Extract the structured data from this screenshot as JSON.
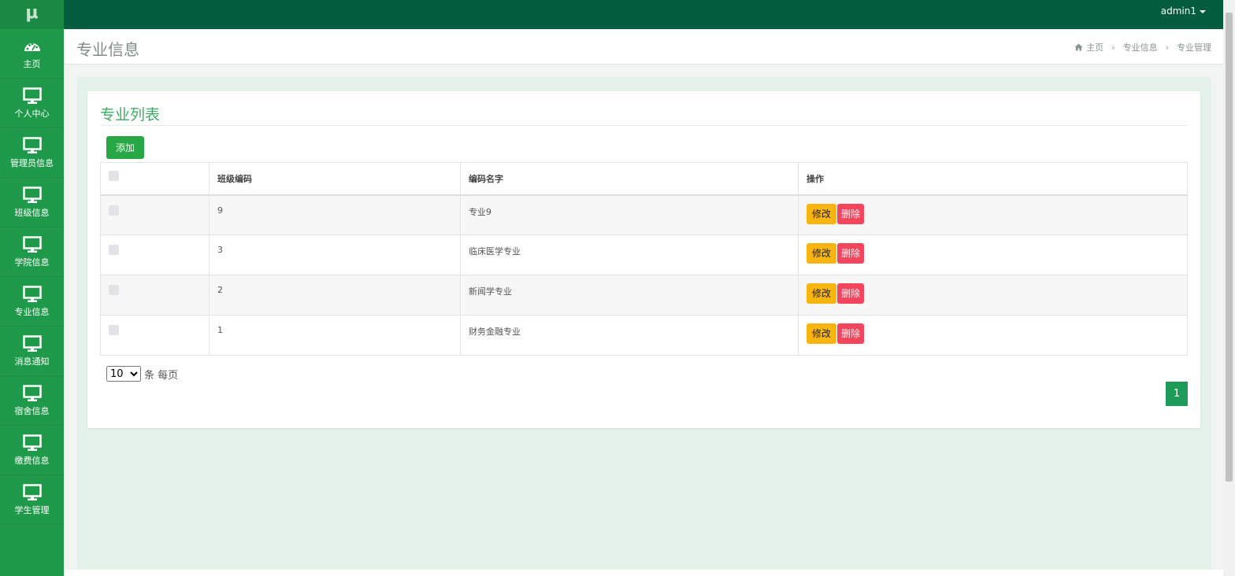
{
  "sidebar": {
    "logo": "μ",
    "items": [
      {
        "label": "主页",
        "icon": "dashboard-icon"
      },
      {
        "label": "个人中心",
        "icon": "monitor-icon"
      },
      {
        "label": "管理员信息",
        "icon": "monitor-icon"
      },
      {
        "label": "班级信息",
        "icon": "monitor-icon"
      },
      {
        "label": "学院信息",
        "icon": "monitor-icon"
      },
      {
        "label": "专业信息",
        "icon": "monitor-icon"
      },
      {
        "label": "消息通知",
        "icon": "monitor-icon"
      },
      {
        "label": "宿舍信息",
        "icon": "monitor-icon"
      },
      {
        "label": "缴费信息",
        "icon": "monitor-icon"
      },
      {
        "label": "学生管理",
        "icon": "monitor-icon"
      }
    ]
  },
  "topbar": {
    "user": "admin1"
  },
  "header": {
    "title": "专业信息",
    "breadcrumb": [
      "主页",
      "专业信息",
      "专业管理"
    ]
  },
  "panel": {
    "title": "专业列表",
    "add_label": "添加",
    "columns": [
      "",
      "班级编码",
      "编码名字",
      "操作"
    ],
    "rows": [
      {
        "code": "9",
        "name": "专业9"
      },
      {
        "code": "3",
        "name": "临床医学专业"
      },
      {
        "code": "2",
        "name": "新闻学专业"
      },
      {
        "code": "1",
        "name": "财务金融专业"
      }
    ],
    "edit_label": "修改",
    "delete_label": "删除",
    "page_size": "10",
    "page_size_suffix": "条 每页",
    "current_page": "1"
  },
  "colors": {
    "sidebar": "#1f9a4b",
    "topbar": "#045c3f",
    "accent": "#3cae63",
    "edit": "#f9b50f",
    "delete": "#f5455c"
  }
}
